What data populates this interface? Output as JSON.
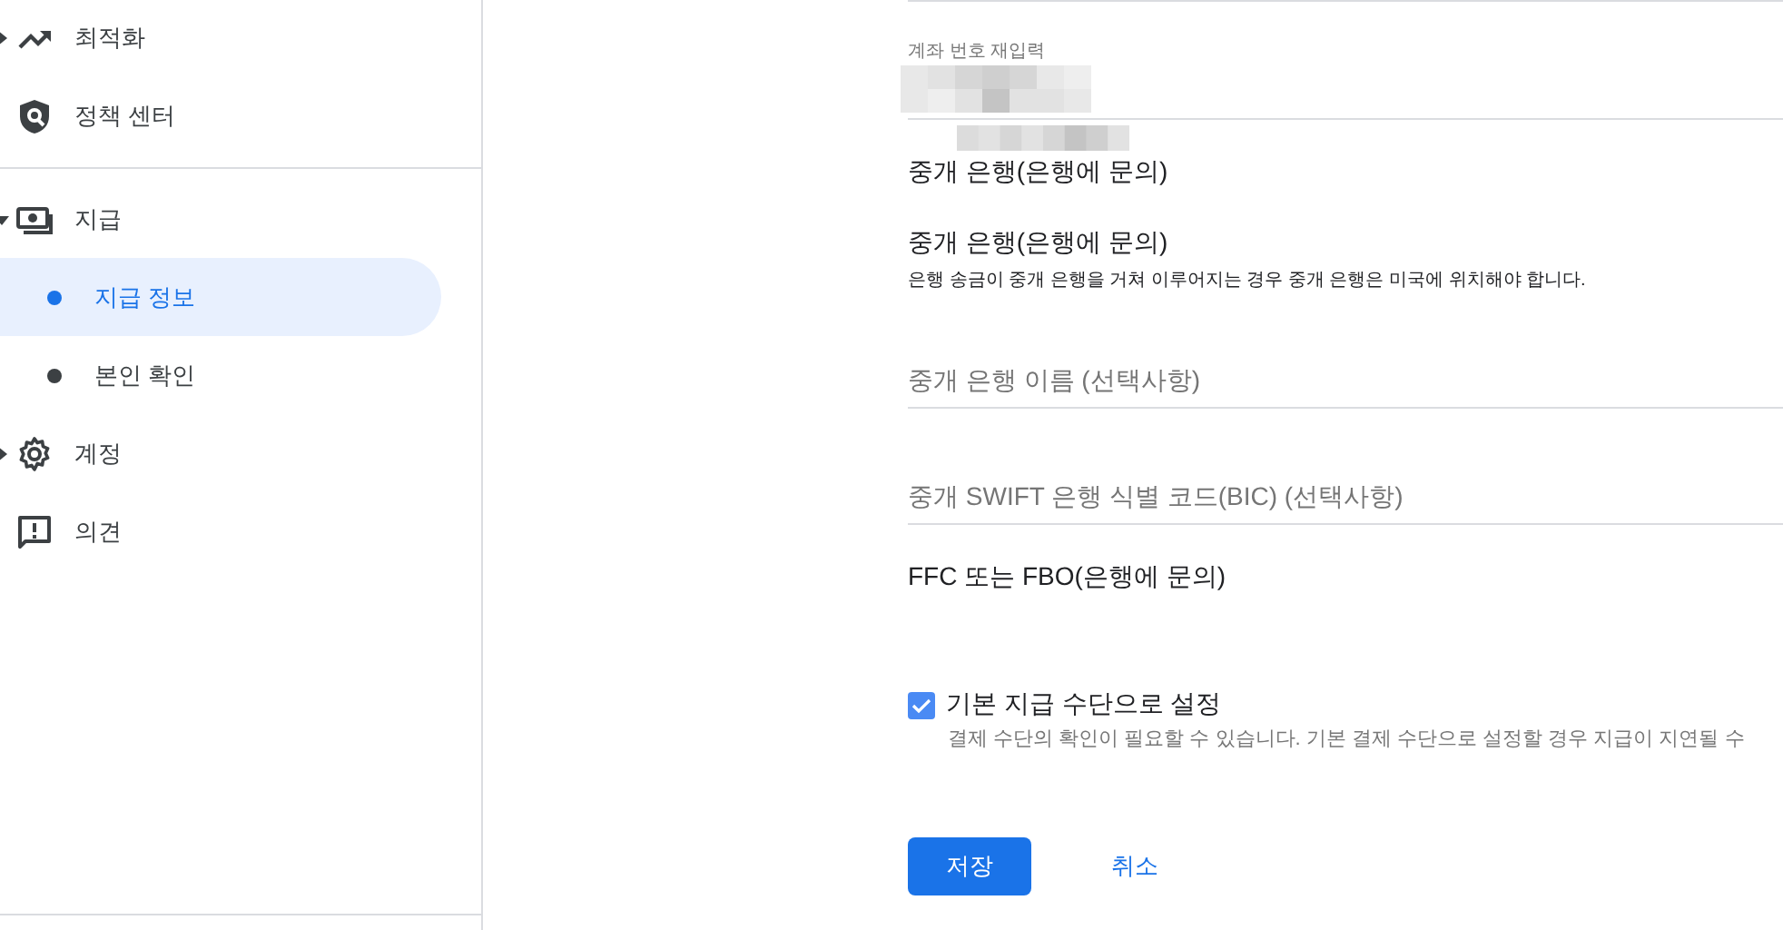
{
  "sidebar": {
    "items": [
      {
        "kind": "group",
        "label": "최적화",
        "expanded": false
      },
      {
        "kind": "link",
        "label": "정책 센터"
      },
      {
        "kind": "divider"
      },
      {
        "kind": "group",
        "label": "지급",
        "expanded": true,
        "children": [
          {
            "label": "지급 정보",
            "selected": true
          },
          {
            "label": "본인 확인",
            "selected": false
          }
        ]
      },
      {
        "kind": "group",
        "label": "계정",
        "expanded": false
      },
      {
        "kind": "link",
        "label": "의견"
      }
    ]
  },
  "form": {
    "rows": [
      {
        "kind": "field",
        "label": "계좌 번호 재입력"
      },
      {
        "kind": "heading",
        "text": "중개 은행(은행에 문의)"
      },
      {
        "kind": "section",
        "title": "중개 은행(은행에 문의)",
        "hint": "은행 송금이 중개 은행을 거쳐 이루어지는 경우 중개 은행은 미국에 위치해야 합니다."
      },
      {
        "kind": "input",
        "placeholder": "중개 은행 이름 (선택사항)"
      },
      {
        "kind": "input",
        "placeholder": "중개 SWIFT 은행 식별 코드(BIC) (선택사항)"
      },
      {
        "kind": "heading",
        "text": "FFC 또는 FBO(은행에 문의)"
      },
      {
        "kind": "checkbox",
        "label": "기본 지급 수단으로 설정",
        "hint": "결제 수단의 확인이 필요할 수 있습니다. 기본 결제 수단으로 설정할 경우 지급이 지연될 수",
        "checked": true
      }
    ],
    "buttons": [
      {
        "kind": "primary",
        "label": "저장"
      },
      {
        "kind": "text",
        "label": "취소"
      }
    ]
  }
}
